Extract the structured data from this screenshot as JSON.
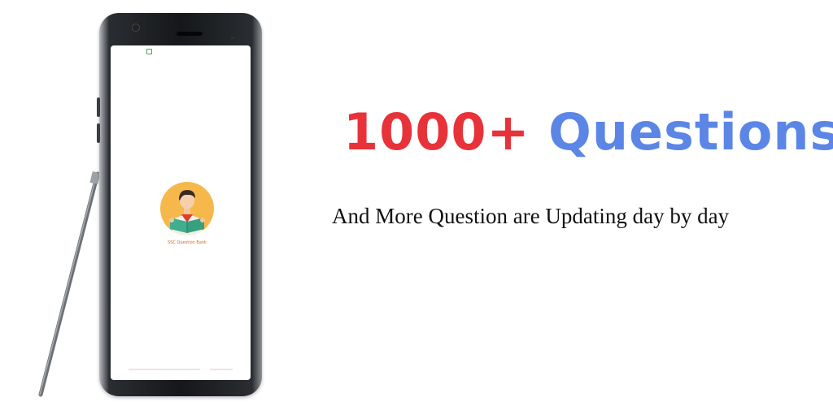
{
  "headline": {
    "number": "1000+",
    "word": "Questions",
    "number_color": "#e8323a",
    "word_color": "#5b86e6"
  },
  "subtitle": "And More Question are Updating day by day",
  "phone": {
    "screen_app": {
      "logo_icon": "student-reading-book-icon",
      "logo_caption": "SSC Question Bank"
    },
    "status_icon": "notification-icon"
  },
  "colors": {
    "background": "#ffffff",
    "logo_circle": "#f6b84b",
    "book": "#3fae8d"
  }
}
